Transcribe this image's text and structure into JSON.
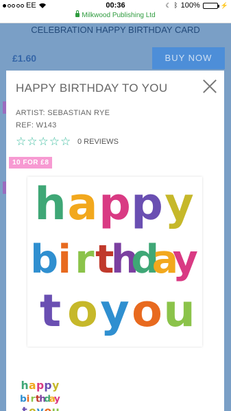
{
  "status_bar": {
    "carrier": "EE",
    "time": "00:36",
    "battery": "100%"
  },
  "url_bar": {
    "site": "Milkwood Publishing Ltd"
  },
  "background_page": {
    "title": "CELEBRATION HAPPY BIRTHDAY CARD",
    "price": "£1.60",
    "buy_label": "BUY NOW"
  },
  "modal": {
    "title": "HAPPY BIRTHDAY TO YOU",
    "artist": "ARTIST: SEBASTIAN RYE",
    "ref": "REF: W143",
    "rating": 0,
    "reviews": "0 REVIEWS",
    "badge": "10 FOR £8"
  },
  "card_art": {
    "line1": [
      "h",
      "a",
      "p",
      "p",
      "y"
    ],
    "line2": [
      "b",
      "i",
      "r",
      "t",
      "h",
      "d",
      "a",
      "y"
    ],
    "line3": [
      "t",
      "o",
      "y",
      "o",
      "u"
    ],
    "colors": [
      "#3fa776",
      "#f2a81d",
      "#d93a83",
      "#6a4fb2",
      "#c6b82a",
      "#2f8fd0",
      "#e86a1f",
      "#8bc34a",
      "#c0392b",
      "#7b3fa0"
    ]
  }
}
